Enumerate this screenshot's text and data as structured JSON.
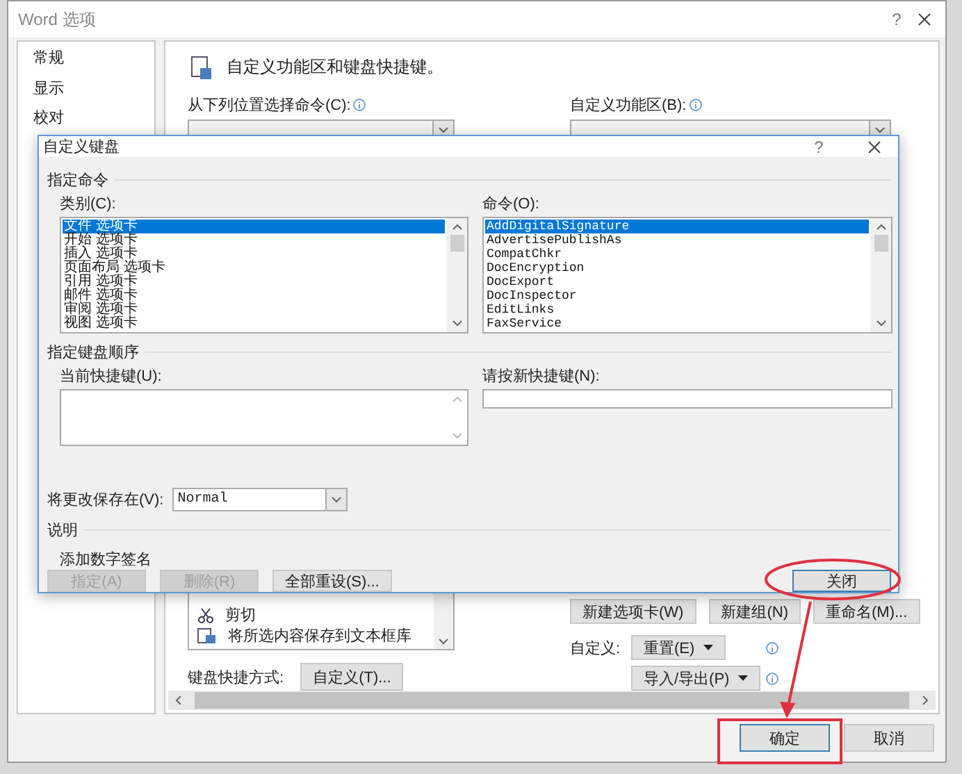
{
  "options_window": {
    "title": "Word 选项",
    "help_glyph": "?",
    "sidebar": [
      {
        "label": "常规",
        "selected": false
      },
      {
        "label": "显示",
        "selected": false
      },
      {
        "label": "校对",
        "selected": false
      }
    ],
    "header": "自定义功能区和键盘快捷键。",
    "choose_commands_label": "从下列位置选择命令(C):",
    "customize_ribbon_label": "自定义功能区(B):",
    "command_list": [
      {
        "label": "剪切",
        "kind": "scissors"
      },
      {
        "label": "将所选内容保存到文本框库",
        "kind": "document"
      }
    ],
    "keyboard_shortcuts": {
      "label": "键盘快捷方式:",
      "button": "自定义(T)..."
    },
    "ribbon_buttons": [
      "新建选项卡(W)",
      "新建组(N)",
      "重命名(M)..."
    ],
    "customize": {
      "label": "自定义:",
      "reset": "重置(E)",
      "import_export": "导入/导出(P)"
    },
    "buttons": [
      {
        "label": "确定",
        "default": true
      },
      {
        "label": "取消",
        "default": false
      }
    ]
  },
  "keyboard_dialog": {
    "title": "自定义键盘",
    "help_glyph": "?",
    "specify_command": "指定命令",
    "categories": {
      "label": "类别(C):",
      "items": [
        {
          "label": "文件 选项卡",
          "selected": true
        },
        {
          "label": "开始 选项卡",
          "selected": false
        },
        {
          "label": "插入 选项卡",
          "selected": false
        },
        {
          "label": "页面布局 选项卡",
          "selected": false
        },
        {
          "label": "引用 选项卡",
          "selected": false
        },
        {
          "label": "邮件 选项卡",
          "selected": false
        },
        {
          "label": "审阅 选项卡",
          "selected": false
        },
        {
          "label": "视图 选项卡",
          "selected": false
        }
      ]
    },
    "commands": {
      "label": "命令(O):",
      "items": [
        {
          "label": "AddDigitalSignature",
          "selected": true
        },
        {
          "label": "AdvertisePublishAs",
          "selected": false
        },
        {
          "label": "CompatChkr",
          "selected": false
        },
        {
          "label": "DocEncryption",
          "selected": false
        },
        {
          "label": "DocExport",
          "selected": false
        },
        {
          "label": "DocInspector",
          "selected": false
        },
        {
          "label": "EditLinks",
          "selected": false
        },
        {
          "label": "FaxService",
          "selected": false
        }
      ]
    },
    "specify_sequence": "指定键盘顺序",
    "current_keys_label": "当前快捷键(U):",
    "new_key_label": "请按新快捷键(N):",
    "save_in": {
      "label": "将更改保存在(V):",
      "value": "Normal"
    },
    "description_title": "说明",
    "description": "添加数字签名",
    "buttons": [
      {
        "label": "指定(A)",
        "disabled": true,
        "default": false
      },
      {
        "label": "删除(R)",
        "disabled": true,
        "default": false
      },
      {
        "label": "全部重设(S)...",
        "disabled": false,
        "default": false
      },
      {
        "label": "关闭",
        "disabled": false,
        "default": true
      }
    ]
  }
}
